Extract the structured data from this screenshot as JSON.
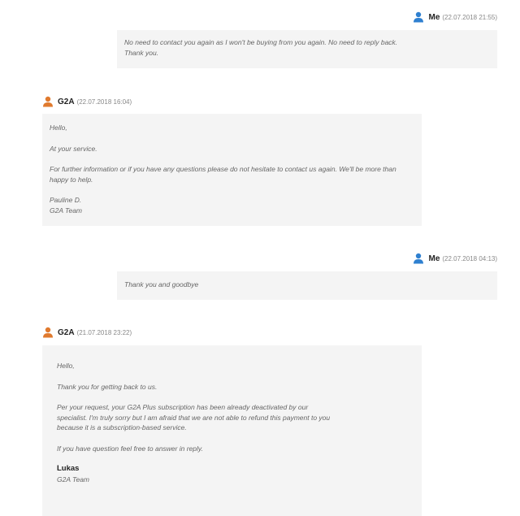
{
  "colors": {
    "me_icon": "#2f80d0",
    "g2a_icon": "#e07a2e",
    "bubble_bg": "#f4f4f4"
  },
  "messages": [
    {
      "sender": "Me",
      "date": "(22.07.2018 21:55)",
      "icon": "user-icon",
      "lines": [
        "No need to contact you again as I won't be buying from you again. No need to reply back.",
        "Thank you."
      ]
    },
    {
      "sender": "G2A",
      "date": "(22.07.2018 16:04)",
      "icon": "user-icon",
      "greeting": "Hello,",
      "p1": "At your service.",
      "p2": "For further information or if you have any questions please do not hesitate to contact us again. We'll be more than happy to help.",
      "sign_name": "Pauline D.",
      "sign_team": "G2A Team"
    },
    {
      "sender": "Me",
      "date": "(22.07.2018 04:13)",
      "icon": "user-icon",
      "text": "Thank you and goodbye"
    },
    {
      "sender": "G2A",
      "date": "(21.07.2018 23:22)",
      "icon": "user-icon",
      "greeting": "Hello,",
      "p1": "Thank you for getting back to us.",
      "p2": "Per your request, your G2A Plus subscription has been already deactivated by our specialist. I'm truly sorry but I am afraid that we are not able to refund this payment to you because it is a subscription-based service.",
      "p3": "If you have question feel free to answer in reply.",
      "sign_name": "Lukas",
      "sign_team": "G2A Team"
    }
  ]
}
